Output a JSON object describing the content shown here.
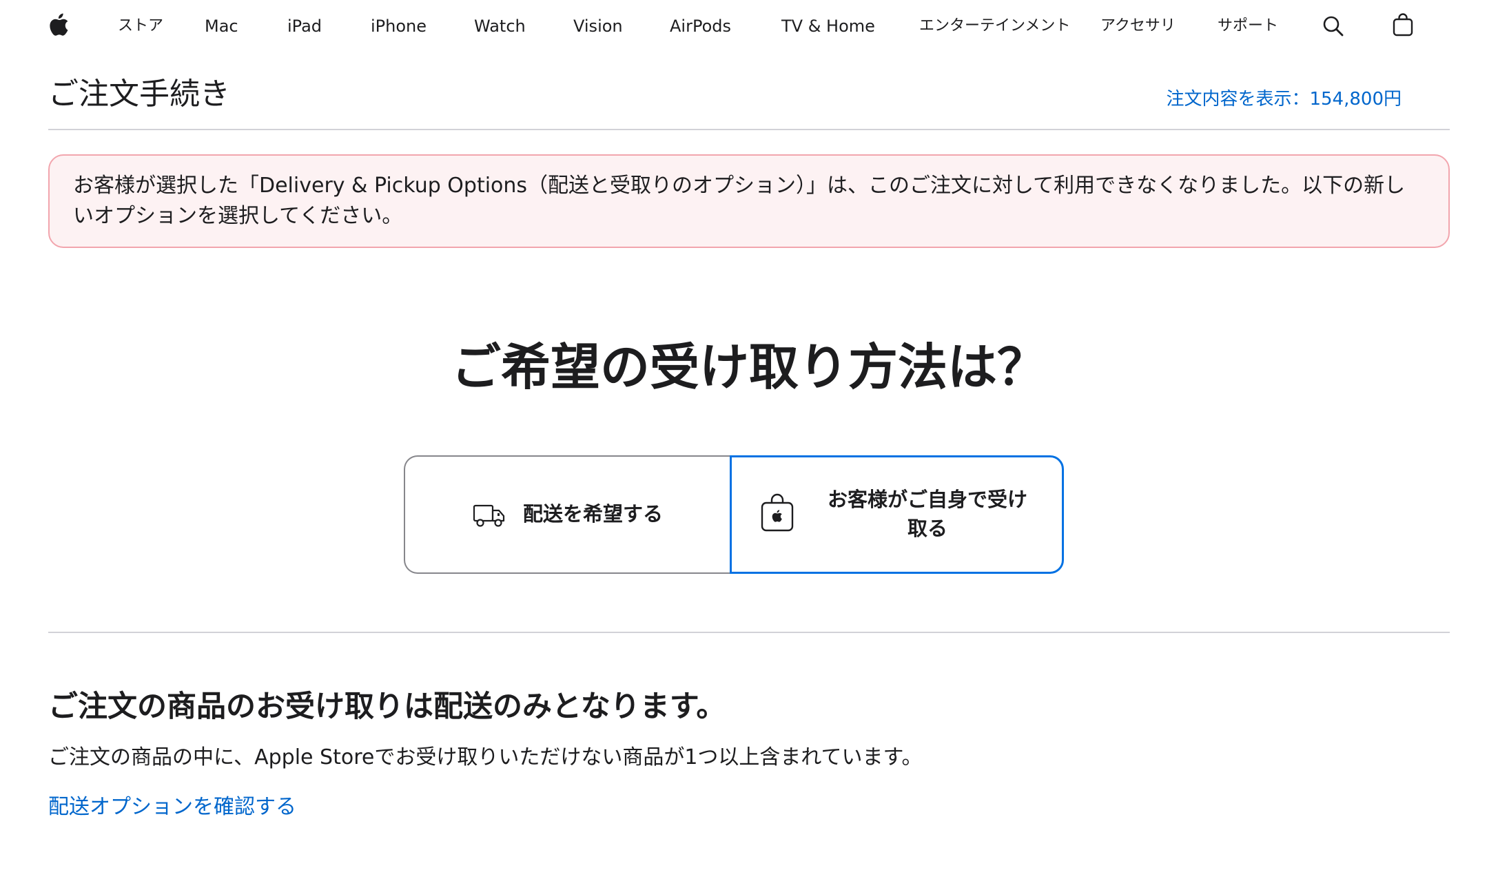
{
  "nav": {
    "apple_logo_icon": "apple-logo-icon",
    "items": [
      "ストア",
      "Mac",
      "iPad",
      "iPhone",
      "Watch",
      "Vision",
      "AirPods",
      "TV & Home",
      "エンターテインメント",
      "アクセサリ",
      "サポート"
    ],
    "search_icon": "search-icon",
    "bag_icon": "shopping-bag-icon"
  },
  "checkout": {
    "title": "ご注文手続き",
    "order_summary_link": "注文内容を表示：154,800円"
  },
  "alert": {
    "message": "お客様が選択した「Delivery & Pickup Options（配送と受取りのオプション）」は、このご注文に対して利用できなくなりました。以下の新しいオプションを選択してください。",
    "border_color": "#f2a5ad",
    "background_color": "#fdf2f3"
  },
  "fulfillment": {
    "question": "ご希望の受け取り方法は？",
    "options": [
      {
        "label": "配送を希望する",
        "icon": "delivery-truck-icon",
        "selected": false
      },
      {
        "label": "お客様がご自身で受け取る",
        "icon": "apple-store-bag-icon",
        "selected": true
      }
    ],
    "selected_border_color": "#0071e3"
  },
  "notice": {
    "title": "ご注文の商品のお受け取りは配送のみとなります。",
    "body": "ご注文の商品の中に、Apple Storeでお受け取りいただけない商品が1つ以上含まれています。",
    "link": "配送オプションを確認する"
  },
  "colors": {
    "link": "#0066cc",
    "text": "#1d1d1f",
    "divider": "#d2d2d7"
  }
}
